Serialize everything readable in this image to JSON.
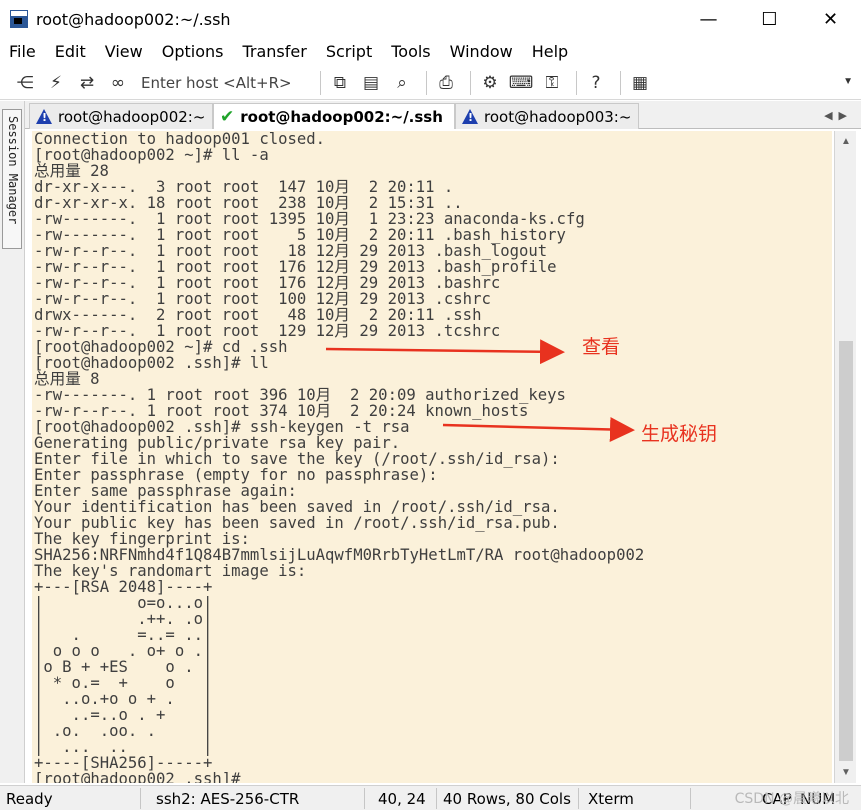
{
  "window": {
    "title": "root@hadoop002:~/.ssh",
    "minimize": "—",
    "maximize": "☐",
    "close": "✕"
  },
  "menu": [
    "File",
    "Edit",
    "View",
    "Options",
    "Transfer",
    "Script",
    "Tools",
    "Window",
    "Help"
  ],
  "toolbar": {
    "host_placeholder": "Enter host <Alt+R>",
    "icons": [
      "connect-icon",
      "lightning-icon",
      "reconnect-icon",
      "link-icon",
      "copy-icon",
      "paste-icon",
      "find-icon",
      "print-icon",
      "settings-icon",
      "keymap-icon",
      "key-icon",
      "help-icon",
      "map-icon"
    ]
  },
  "side_tab": {
    "label": "Session Manager"
  },
  "tabs": [
    {
      "label": "root@hadoop002:~",
      "status": "warning"
    },
    {
      "label": "root@hadoop002:~/.ssh",
      "status": "connected",
      "close": "✕"
    },
    {
      "label": "root@hadoop003:~",
      "status": "warning"
    }
  ],
  "terminal": {
    "background": "#fbf1da",
    "lines": [
      "Connection to hadoop001 closed.",
      "[root@hadoop002 ~]# ll -a",
      "总用量 28",
      "dr-xr-x---.  3 root root  147 10月  2 20:11 .",
      "dr-xr-xr-x. 18 root root  238 10月  2 15:31 ..",
      "-rw-------.  1 root root 1395 10月  1 23:23 anaconda-ks.cfg",
      "-rw-------.  1 root root    5 10月  2 20:11 .bash_history",
      "-rw-r--r--.  1 root root   18 12月 29 2013 .bash_logout",
      "-rw-r--r--.  1 root root  176 12月 29 2013 .bash_profile",
      "-rw-r--r--.  1 root root  176 12月 29 2013 .bashrc",
      "-rw-r--r--.  1 root root  100 12月 29 2013 .cshrc",
      "drwx------.  2 root root   48 10月  2 20:11 .ssh",
      "-rw-r--r--.  1 root root  129 12月 29 2013 .tcshrc",
      "[root@hadoop002 ~]# cd .ssh",
      "[root@hadoop002 .ssh]# ll",
      "总用量 8",
      "-rw-------. 1 root root 396 10月  2 20:09 authorized_keys",
      "-rw-r--r--. 1 root root 374 10月  2 20:24 known_hosts",
      "[root@hadoop002 .ssh]# ssh-keygen -t rsa",
      "Generating public/private rsa key pair.",
      "Enter file in which to save the key (/root/.ssh/id_rsa):",
      "Enter passphrase (empty for no passphrase):",
      "Enter same passphrase again:",
      "Your identification has been saved in /root/.ssh/id_rsa.",
      "Your public key has been saved in /root/.ssh/id_rsa.pub.",
      "The key fingerprint is:",
      "SHA256:NRFNmhd4f1Q84B7mmlsijLuAqwfM0RrbTyHetLmT/RA root@hadoop002",
      "The key's randomart image is:",
      "+---[RSA 2048]----+",
      "|          o=o...o|",
      "|          .++. .o|",
      "|   .      =..= ..|",
      "| o o o   . o+ o .|",
      "|o B + +ES    o . |",
      "| * o.=  +    o   |",
      "|  ..o.+o o + .   |",
      "|   ..=..o . +    |",
      "| .o.  .oo. .     |",
      "|  ...  ..        |",
      "+----[SHA256]-----+",
      "[root@hadoop002 .ssh]# "
    ]
  },
  "annotations": {
    "view": "查看",
    "keygen": "生成秘钥",
    "color": "#e8321f"
  },
  "status": {
    "ready": "Ready",
    "cipher": "ssh2: AES-256-CTR",
    "cursor": "40,  24",
    "size": "40 Rows, 80 Cols",
    "term": "Xterm",
    "caps": "CAP",
    "num": "NUM"
  },
  "watermark": "CSDN @晨曦以北"
}
